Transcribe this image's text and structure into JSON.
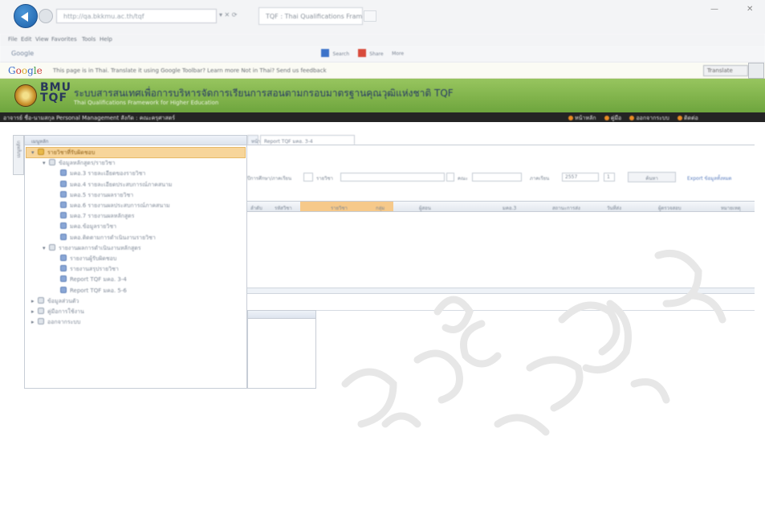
{
  "browser": {
    "address": "http://qa.bkkmu.ac.th/tqf",
    "tab_title": "TQF : Thai Qualifications Framework",
    "menu": [
      "File",
      "Edit",
      "View",
      "Favorites",
      "Tools",
      "Help"
    ],
    "toolbar_google": "Google",
    "toolbar_items": [
      "Search",
      "Share",
      "More"
    ],
    "translate_message": "This page is in Thai. Translate it using Google Toolbar? Learn more  Not in Thai? Send us feedback",
    "translate_button": "Translate",
    "controls": "▾ ✕ ⟳"
  },
  "header": {
    "logo_line1": "BMU",
    "logo_line2": "TQF",
    "title": "ระบบสารสนเทศเพื่อการบริหารจัดการเรียนการสอนตามกรอบมาตรฐานคุณวุฒิแห่งชาติ TQF",
    "subtitle": "Thai Qualifications Framework for Higher Education",
    "user_info": "อาจารย์ ชื่อ-นามสกุล  Personal Management   สังกัด : คณะครุศาสตร์",
    "nav_links": [
      "หน้าหลัก",
      "คู่มือ",
      "ออกจากระบบ",
      "ติดต่อ"
    ]
  },
  "sidebar": {
    "collapse_label": "เมนูหลัก",
    "panel_title": "เมนูหลัก",
    "items": [
      {
        "label": "รายวิชาที่รับผิดชอบ",
        "level": 0,
        "type": "folder"
      },
      {
        "label": "ข้อมูลหลักสูตร/รายวิชา",
        "level": 1,
        "type": "group"
      },
      {
        "label": "มคอ.3 รายละเอียดของรายวิชา",
        "level": 2,
        "type": "leaf"
      },
      {
        "label": "มคอ.4 รายละเอียดประสบการณ์ภาคสนาม",
        "level": 2,
        "type": "leaf"
      },
      {
        "label": "มคอ.5 รายงานผลรายวิชา",
        "level": 2,
        "type": "leaf"
      },
      {
        "label": "มคอ.6 รายงานผลประสบการณ์ภาคสนาม",
        "level": 2,
        "type": "leaf"
      },
      {
        "label": "มคอ.7 รายงานผลหลักสูตร",
        "level": 2,
        "type": "leaf"
      },
      {
        "label": "มคอ.ข้อมูลรายวิชา",
        "level": 2,
        "type": "leaf"
      },
      {
        "label": "มคอ.ติดตามการดำเนินงานรายวิชา",
        "level": 2,
        "type": "leaf"
      },
      {
        "label": "รายงานผลการดำเนินงานหลักสูตร",
        "level": 1,
        "type": "group"
      },
      {
        "label": "รายงานผู้รับผิดชอบ",
        "level": 2,
        "type": "leaf"
      },
      {
        "label": "รายงานสรุปรายวิชา",
        "level": 2,
        "type": "leaf"
      },
      {
        "label": "Report TQF มคอ. 3-4",
        "level": 2,
        "type": "leaf"
      },
      {
        "label": "Report TQF มคอ. 5-6",
        "level": 2,
        "type": "leaf"
      },
      {
        "label": "ข้อมูลส่วนตัว",
        "level": 0,
        "type": "group"
      },
      {
        "label": "คู่มือการใช้งาน",
        "level": 0,
        "type": "group"
      },
      {
        "label": "ออกจากระบบ",
        "level": 0,
        "type": "group"
      }
    ]
  },
  "content": {
    "tabs": [
      "หน้าแรก",
      "Report TQF มคอ. 3-4"
    ],
    "filters": {
      "year_label": "ปีการศึกษา/ภาคเรียน",
      "course_label": "รายวิชา",
      "faculty_label": "คณะ",
      "term_label": "ภาคเรียน",
      "term_value": "2557",
      "round_value": "1",
      "search_button": "ค้นหา",
      "export_link": "Export ข้อมูลทั้งหมด"
    },
    "grid_headers": [
      "ลำดับ",
      "รหัสวิชา",
      "รายวิชา",
      "กลุ่ม",
      "ผู้สอน",
      "มคอ.3",
      "สถานะการส่ง",
      "วันที่ส่ง",
      "ผู้ตรวจสอบ",
      "หมายเหตุ"
    ]
  },
  "colors": {
    "header_green": "#7fb24a",
    "selection": "#f7d59a",
    "nav_dark": "#242424",
    "accent_orange": "#e88b25"
  }
}
